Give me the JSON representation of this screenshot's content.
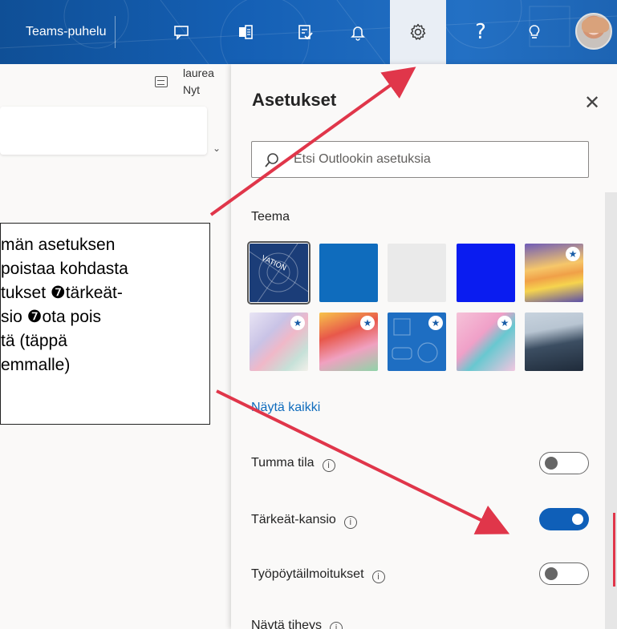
{
  "topbar": {
    "teams_call_label": "Teams-puhelu",
    "icons": [
      "chat-icon",
      "word-icon",
      "task-icon",
      "bell-icon",
      "gear-icon",
      "help-icon",
      "lightbulb-icon",
      "avatar"
    ],
    "help_glyph": "?"
  },
  "left": {
    "user": "laurea",
    "time": "Nyt"
  },
  "settings": {
    "title": "Asetukset",
    "close_glyph": "✕",
    "search_placeholder": "Etsi Outlookin asetuksia",
    "theme_label": "Teema",
    "theme_watermark": "VATION",
    "show_all": "Näytä kaikki",
    "rows": [
      {
        "label": "Tumma tila",
        "state": "off"
      },
      {
        "label": "Tärkeät-kansio",
        "state": "on"
      },
      {
        "label": "Työpöytäilmoitukset",
        "state": "off"
      },
      {
        "label": "Näytä tiheys",
        "state": ""
      }
    ],
    "info_glyph": "i",
    "star_glyph": "★"
  },
  "callout": {
    "lines": [
      "män asetuksen",
      "poistaa kohdasta",
      "tukset ❼tärkeät-",
      "sio ❼ota pois",
      "tä (täppä",
      "emmalle)"
    ]
  },
  "colors": {
    "accent": "#0f5fb8",
    "link": "#0f6cbd",
    "arrow": "#e0364a"
  }
}
